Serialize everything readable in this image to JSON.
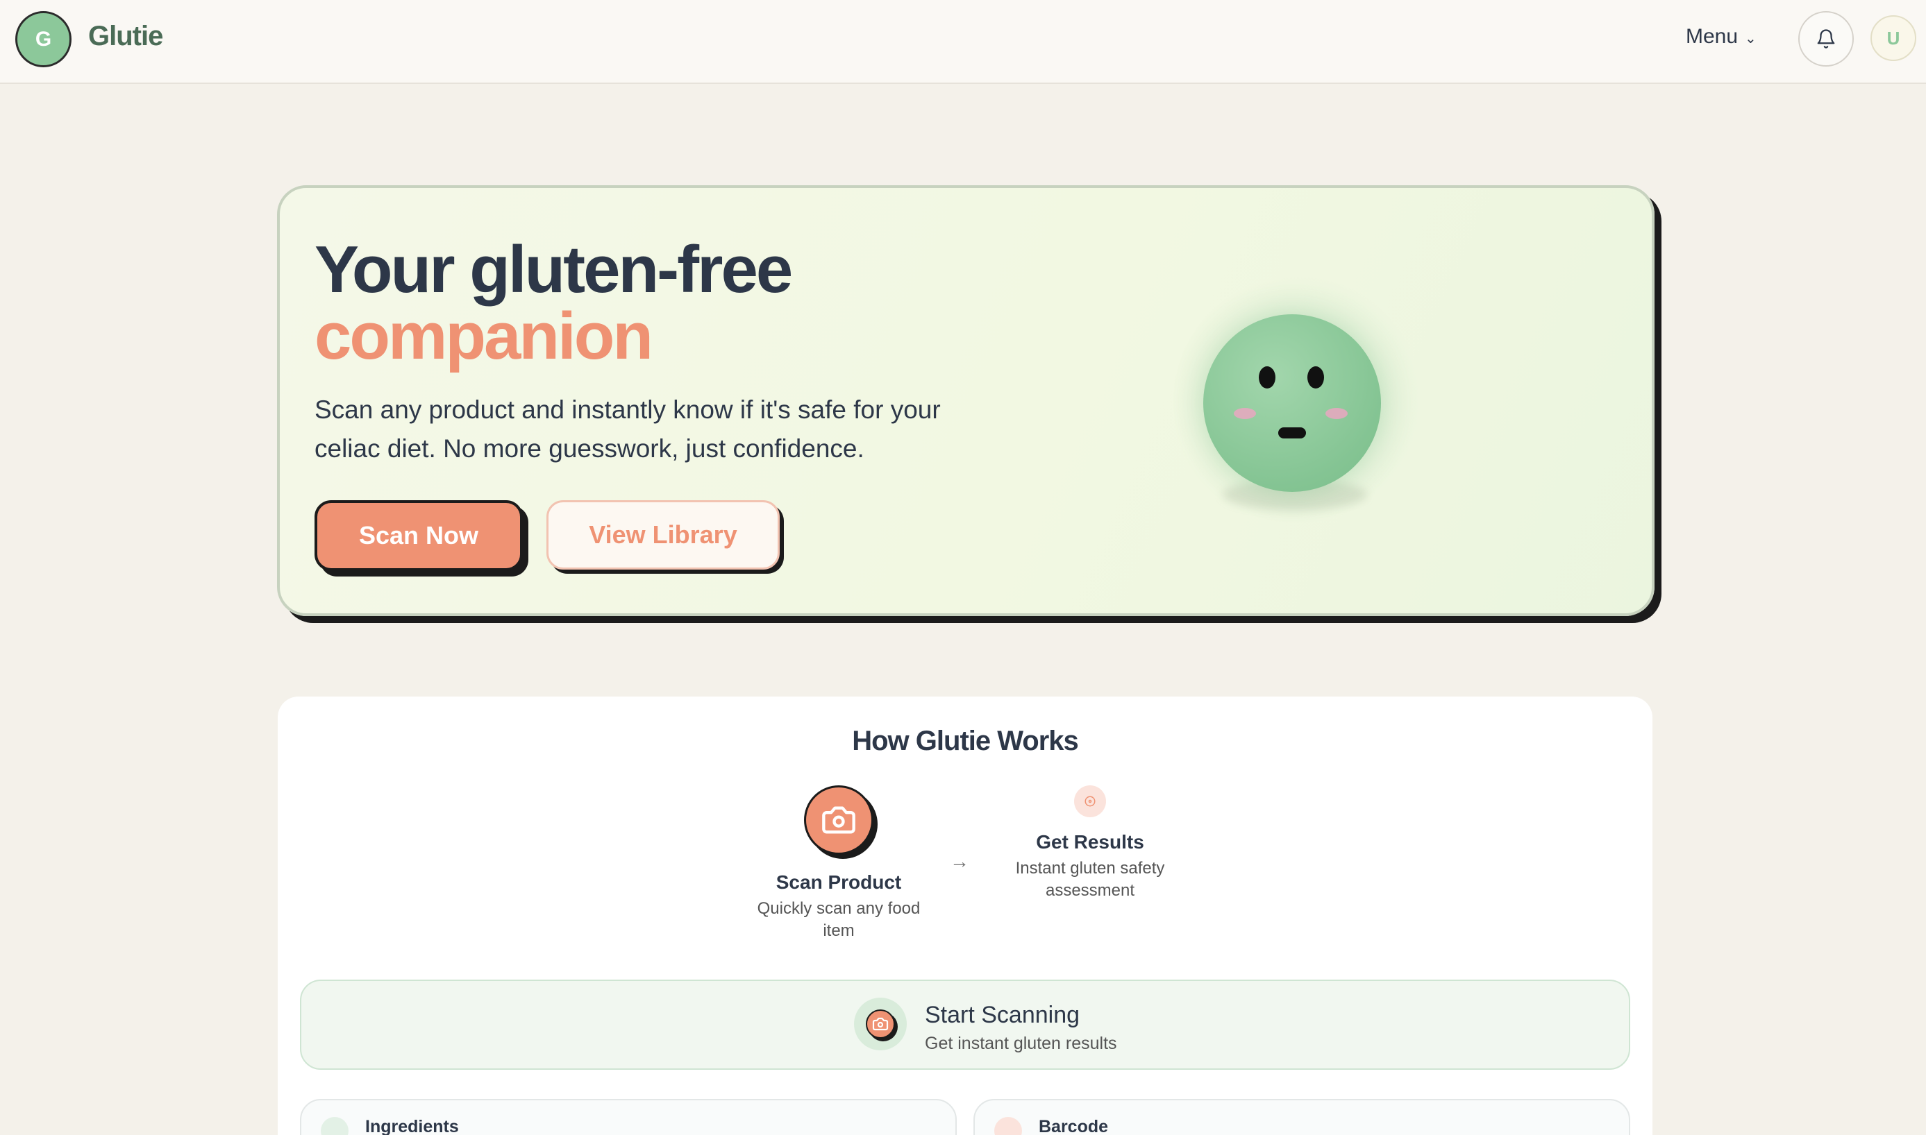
{
  "header": {
    "logo_letter": "G",
    "brand": "Glutie",
    "menu_label": "Menu",
    "user_initial": "U"
  },
  "hero": {
    "title_line1": "Your gluten-free",
    "title_line2": "companion",
    "subtitle": "Scan any product and instantly know if it's safe for your celiac diet. No more guesswork, just confidence.",
    "scan_button": "Scan Now",
    "library_button": "View Library"
  },
  "how_it_works": {
    "title": "How Glutie Works",
    "steps": [
      {
        "title": "Scan Product",
        "description": "Quickly scan any food item",
        "icon": "camera-icon"
      },
      {
        "title": "Get Results",
        "description": "Instant gluten safety assessment",
        "icon": "info-icon"
      }
    ],
    "start_scanning": {
      "title": "Start Scanning",
      "subtitle": "Get instant gluten results"
    },
    "modes": [
      {
        "label": "Ingredients",
        "icon": "scan-text-icon"
      },
      {
        "label": "Barcode",
        "icon": "barcode-icon"
      }
    ]
  },
  "colors": {
    "accent": "#ef9273",
    "brand_green": "#8cc89a",
    "navy": "#2d3748",
    "background": "#f4f1ea"
  }
}
